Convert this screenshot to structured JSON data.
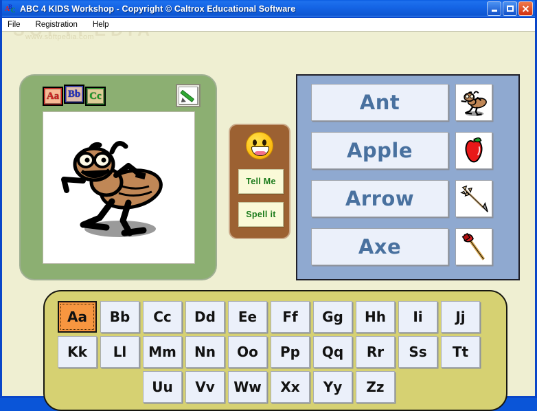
{
  "window": {
    "title": "ABC 4 KIDS Workshop - Copyright © Caltrox Educational Software",
    "app_icon": "abc-blocks-icon",
    "minimize_label": "Minimize",
    "maximize_label": "Maximize",
    "close_label": "Close"
  },
  "menu": {
    "items": [
      {
        "label": "File"
      },
      {
        "label": "Registration"
      },
      {
        "label": "Help"
      }
    ]
  },
  "watermark": {
    "big": "SOFTPEDIA",
    "small": "www.softpedia.com"
  },
  "picture_panel": {
    "blocks_icon": "abc-blocks-icon",
    "blocks": [
      {
        "upper": "A",
        "lower": "a",
        "color": "#D42020"
      },
      {
        "upper": "B",
        "lower": "b",
        "color": "#2030C8"
      },
      {
        "upper": "C",
        "lower": "c",
        "color": "#18A028"
      }
    ],
    "draw_button": "pencil-icon",
    "image_alt": "ant"
  },
  "action_panel": {
    "face_icon": "smiley-face-icon",
    "buttons": [
      {
        "label": "Tell Me",
        "name": "tell-me-button"
      },
      {
        "label": "Spell it",
        "name": "spell-it-button"
      }
    ]
  },
  "words_panel": {
    "items": [
      {
        "label": "Ant",
        "thumb": "ant-thumbnail"
      },
      {
        "label": "Apple",
        "thumb": "apple-thumbnail"
      },
      {
        "label": "Arrow",
        "thumb": "arrow-thumbnail"
      },
      {
        "label": "Axe",
        "thumb": "axe-thumbnail"
      }
    ]
  },
  "keyboard": {
    "selected": "Aa",
    "rows": [
      [
        "Aa",
        "Bb",
        "Cc",
        "Dd",
        "Ee",
        "Ff",
        "Gg",
        "Hh",
        "Ii",
        "Jj"
      ],
      [
        "Kk",
        "Ll",
        "Mm",
        "Nn",
        "Oo",
        "Pp",
        "Qq",
        "Rr",
        "Ss",
        "Tt"
      ],
      [
        "",
        "",
        "Uu",
        "Vv",
        "Ww",
        "Xx",
        "Yy",
        "Zz",
        "",
        ""
      ]
    ]
  },
  "colors": {
    "titlebar": "#1565E6",
    "desktop": "#EFEFD2",
    "green_panel": "#8CAF72",
    "brown_panel": "#9C6132",
    "blue_panel": "#8FA9D0",
    "keyboard_panel": "#D6D172",
    "word_text": "#49719F",
    "selected_key": "#F79640",
    "button_text_green": "#1A7A1A"
  }
}
